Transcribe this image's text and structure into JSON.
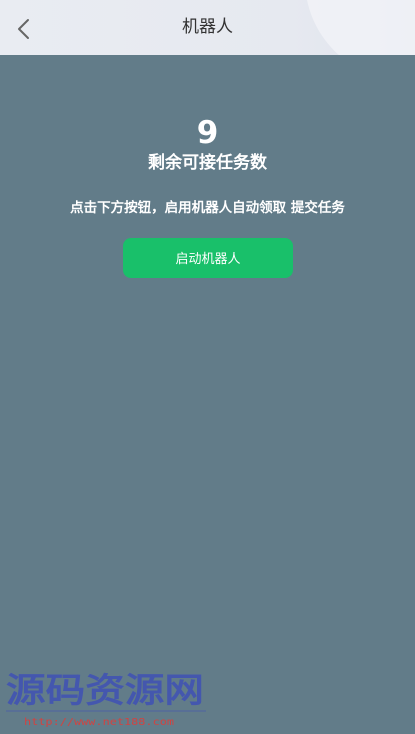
{
  "header": {
    "title": "机器人",
    "back_icon": "chevron-left-icon"
  },
  "main": {
    "remaining_count": "9",
    "remaining_label": "剩余可接任务数",
    "instruction": "点击下方按钮，启用机器人自动领取 提交任务",
    "start_button_label": "启动机器人"
  },
  "watermark": {
    "text": "源码资源网",
    "url": "http://www.net188.com"
  },
  "colors": {
    "background": "#627c89",
    "header": "#e6e9f0",
    "accent": "#19c06a",
    "watermark": "#3f51b5",
    "watermark_url": "#e53935"
  }
}
